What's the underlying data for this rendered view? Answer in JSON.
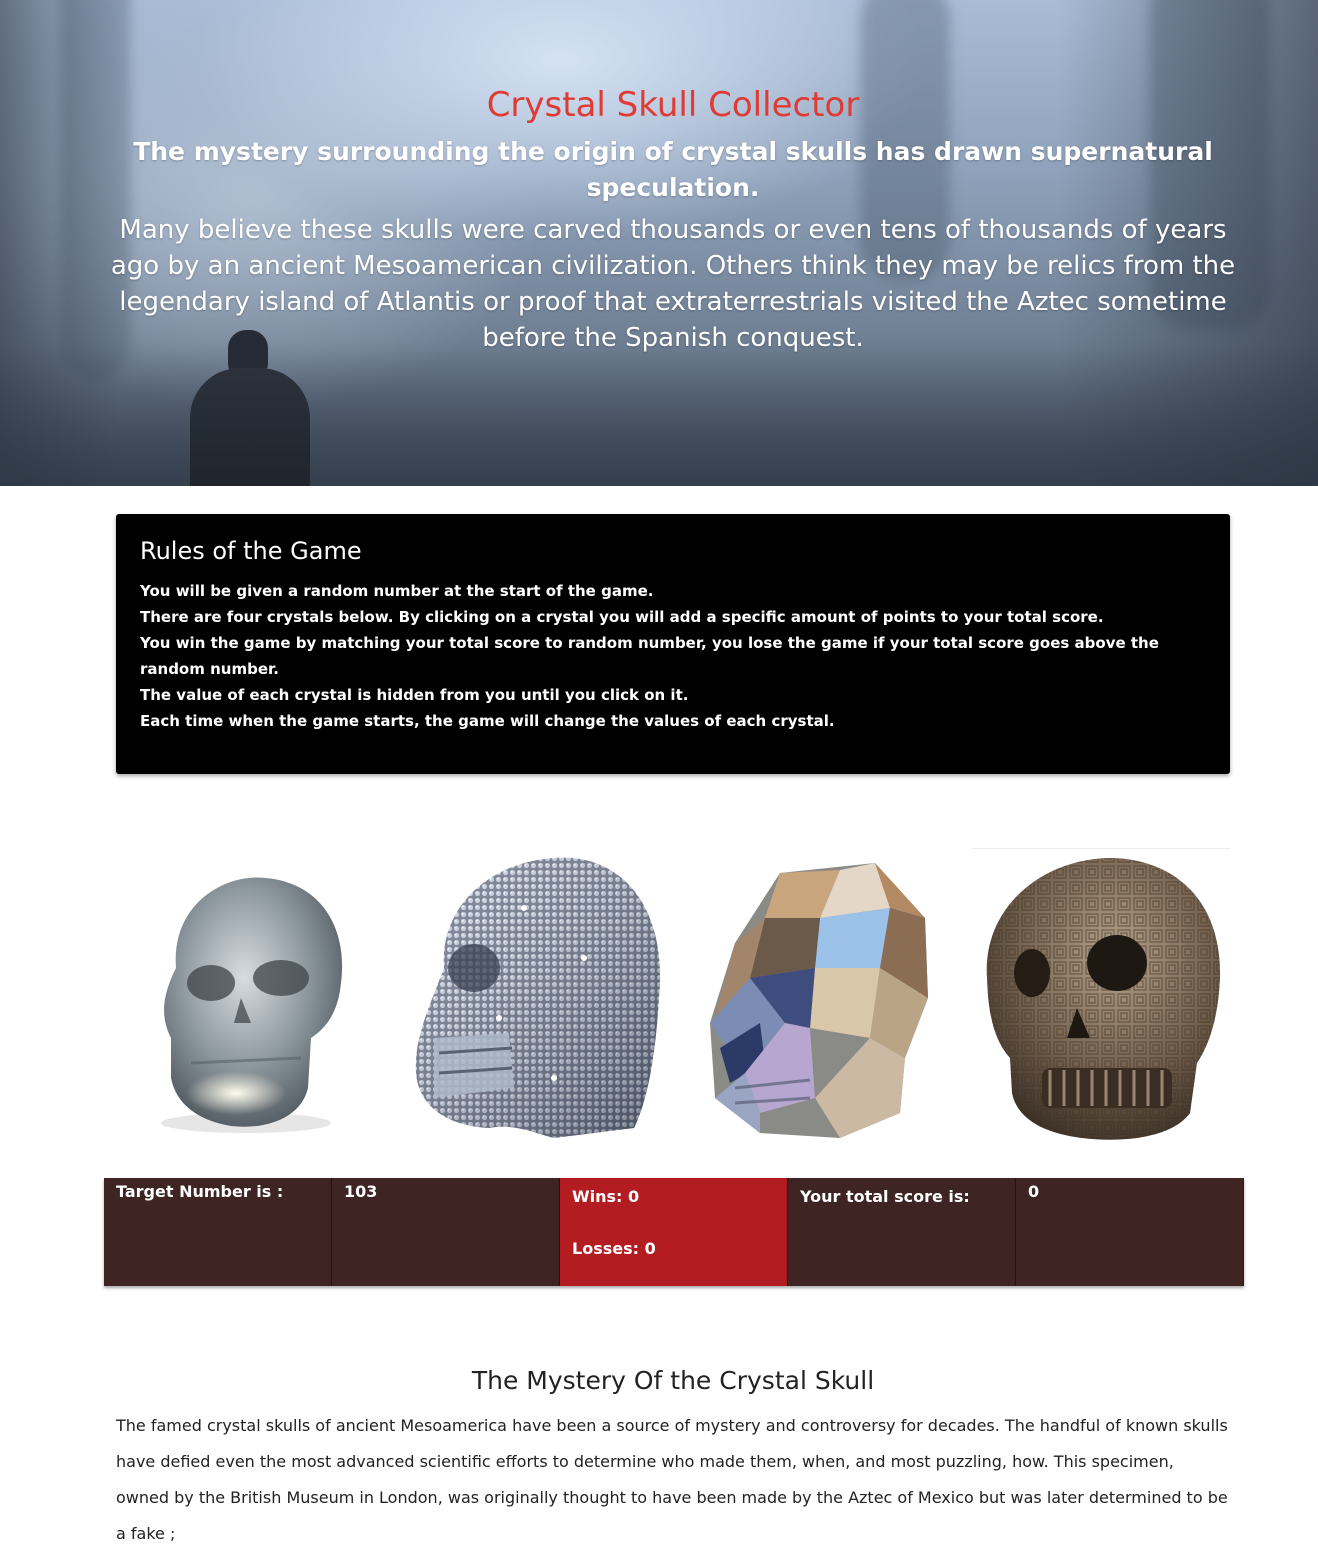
{
  "hero": {
    "title": "Crystal Skull Collector",
    "subtitle": "The mystery surrounding the origin of crystal skulls has drawn supernatural speculation.",
    "text": "Many believe these skulls were carved thousands or even tens of thousands of years ago by an ancient Mesoamerican civilization. Others think they may be relics from the legendary island of Atlantis or proof that extraterrestrials visited the Aztec sometime before the Spanish conquest."
  },
  "rules": {
    "title": "Rules of the Game",
    "items": [
      "You will be given a random number at the start of the game.",
      "There are four crystals below. By clicking on a crystal you will add a specific amount of points to your total score.",
      "You win the game by matching your total score to random number, you lose the game if your total score goes above the random number.",
      "The value of each crystal is hidden from you until you click on it.",
      "Each time when the game starts, the game will change the values of each crystal."
    ]
  },
  "crystals": [
    {
      "icon": "clear-quartz-skull-icon"
    },
    {
      "icon": "rhinestone-skull-icon"
    },
    {
      "icon": "faceted-crystal-skull-icon"
    },
    {
      "icon": "aztec-bronze-skull-icon"
    }
  ],
  "scoreboard": {
    "target_label": "Target Number is :",
    "target_value": "103",
    "wins": "Wins: 0",
    "losses": "Losses: 0",
    "total_label": "Your total score is:",
    "total_value": "0"
  },
  "mystery": {
    "title": "The Mystery Of the Crystal Skull",
    "text": "The famed crystal skulls of ancient Mesoamerica have been a source of mystery and controversy for decades. The handful of known skulls have defied even the most advanced scientific efforts to determine who made them, when, and most puzzling, how. This specimen, owned by the British Museum in London, was originally thought to have been made by the Aztec of Mexico but was later determined to be a fake ;"
  },
  "colors": {
    "title_red": "#e03a32",
    "rules_bg": "#000000",
    "cell_brown": "#3e2523",
    "cell_red": "#b31d22"
  }
}
